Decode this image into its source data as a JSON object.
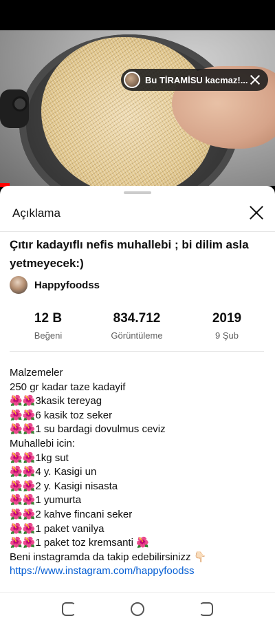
{
  "video": {
    "promo_text": "Bu TİRAMİSU kacmaz!..."
  },
  "sheet": {
    "title": "Açıklama"
  },
  "details": {
    "video_title": "Çıtır kadayıflı nefis muhallebi ; bi dilim asla yetmeyecek:)",
    "channel_name": "Happyfoodss"
  },
  "stats": [
    {
      "value": "12 B",
      "label": "Beğeni"
    },
    {
      "value": "834.712",
      "label": "Görüntüleme"
    },
    {
      "value": "2019",
      "label": "9 Şub"
    }
  ],
  "description": {
    "lines": [
      "Malzemeler",
      "250 gr kadar taze kadayif",
      "🌺🌺3kasik tereyag",
      "🌺🌺6 kasik toz seker",
      "🌺🌺1 su bardagi dovulmus ceviz",
      "Muhallebi icin:",
      "🌺🌺1kg sut",
      "🌺🌺4 y. Kasigi un",
      "🌺🌺2 y. Kasigi nisasta",
      "🌺🌺1 yumurta",
      "🌺🌺2 kahve fincani seker",
      "🌺🌺1 paket vanilya",
      "🌺🌺1 paket toz kremsanti 🌺",
      "Beni instagramda da takip edebilirsinizz 👇🏻"
    ],
    "link": "https://www.instagram.com/happyfoodss"
  }
}
